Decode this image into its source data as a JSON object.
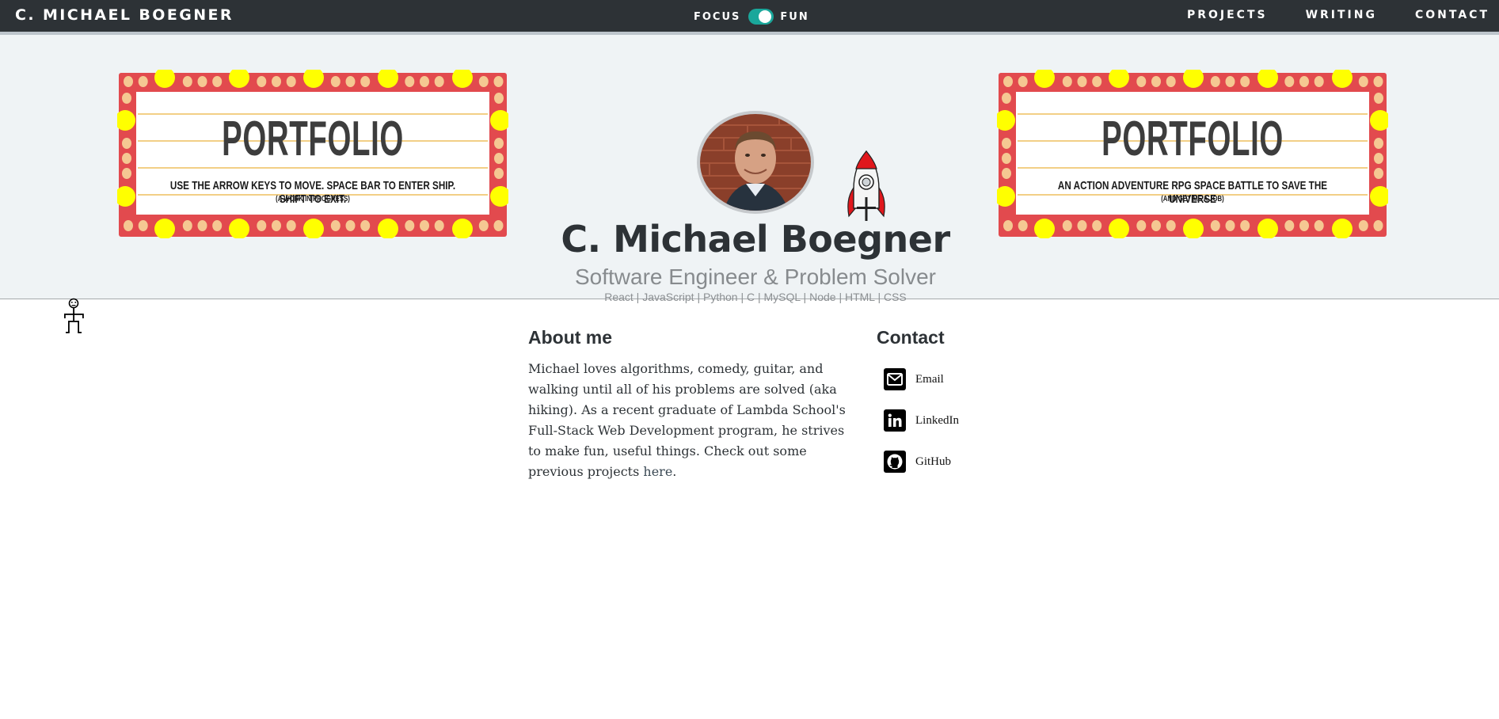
{
  "nav": {
    "brand": "C. MICHAEL BOEGNER",
    "mode_left": "FOCUS",
    "mode_right": "FUN",
    "links": [
      "PROJECTS",
      "WRITING",
      "CONTACT"
    ]
  },
  "colors": {
    "nav_bg": "#2d3236",
    "toggle": "#1aa79b",
    "hero_bg": "#eff3f5",
    "marquee_frame": "#e24a4e",
    "marquee_bulb_on": "#ffff00",
    "marquee_bulb_off": "#f5c892"
  },
  "hero": {
    "name": "C. Michael Boegner",
    "tagline": "Software Engineer & Problem Solver",
    "skills": "React | JavaScript | Python | C | MySQL | Node | HTML | CSS",
    "left_marquee": {
      "title": "PORTFOLIO",
      "subtitle": "USE THE ARROW KEYS TO MOVE. SPACE BAR TO ENTER SHIP. SHIFT TO EXIT.",
      "small": "(A WORK IN PROGRESS)"
    },
    "right_marquee": {
      "title": "PORTFOLIO",
      "subtitle": "AN ACTION ADVENTURE RPG SPACE BATTLE TO SAVE THE UNIVERSE",
      "small": "(AND GET ME A JOB)"
    }
  },
  "about": {
    "heading": "About me",
    "body": "Michael loves algorithms, comedy, guitar, and walking until all of his problems are solved (aka hiking). As a recent graduate of Lambda School's Full-Stack Web Development program, he strives to make fun, useful things. Check out some previous projects ",
    "link": "here",
    "tail": "."
  },
  "contact": {
    "heading": "Contact",
    "items": [
      {
        "label": "Email",
        "icon": "envelope-icon"
      },
      {
        "label": "LinkedIn",
        "icon": "linkedin-icon"
      },
      {
        "label": "GitHub",
        "icon": "github-icon"
      }
    ]
  }
}
